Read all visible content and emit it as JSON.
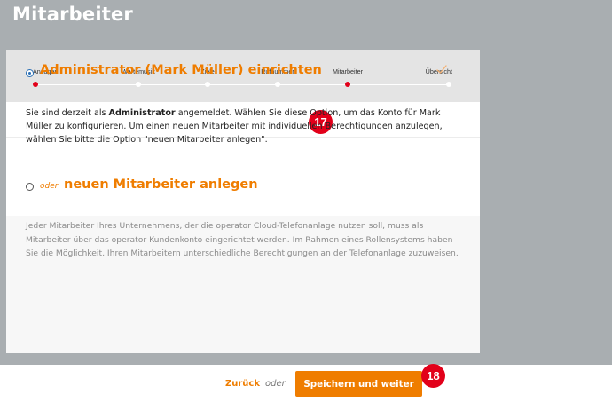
{
  "page": {
    "title": "Mitarbeiter"
  },
  "stepper": {
    "steps": [
      {
        "label": "Ansagen",
        "active": true
      },
      {
        "label": "Wartemusik",
        "active": false
      },
      {
        "label": "Ziele",
        "active": false
      },
      {
        "label": "Rufnummer",
        "active": false
      },
      {
        "label": "Mitarbeiter",
        "active": true
      },
      {
        "label": "Übersicht",
        "active": false
      }
    ]
  },
  "option_admin": {
    "title": "Administrator (Mark Müller) einrichten",
    "selected": true,
    "desc_prefix": "Sie sind derzeit als ",
    "desc_bold": "Administrator",
    "desc_rest": " angemeldet. Wählen Sie diese Option, um das Konto für Mark Müller zu konfigurieren. Um einen neuen Mitarbeiter mit individuellen Berechtigungen anzulegen, wählen Sie bitte die Option \"neuen Mitarbeiter anlegen\"."
  },
  "option_new": {
    "prefix": "oder",
    "title": "neuen Mitarbeiter anlegen",
    "selected": false,
    "desc": "Jeder Mitarbeiter Ihres Unternehmens, der die operator Cloud-Telefonanlage nutzen soll, muss als Mitarbeiter über das operator Kundenkonto eingerichtet werden. Im Rahmen eines Rollensystems haben Sie die Möglichkeit, Ihren Mitarbeitern unterschiedliche Berechtigungen an der Telefonanlage zuzuweisen."
  },
  "footer": {
    "back_label": "Zurück",
    "or_label": "oder",
    "save_label": "Speichern und weiter"
  },
  "badges": {
    "badge_1": "17",
    "badge_2": "18"
  },
  "icons": {
    "check": "check-icon",
    "radio_on": "radio-checked-icon",
    "radio_off": "radio-empty-icon"
  },
  "colors": {
    "accent": "#ef7d00",
    "active_dot": "#e2001a",
    "radio": "#2a6fb5",
    "background": "#a9aeb1"
  }
}
